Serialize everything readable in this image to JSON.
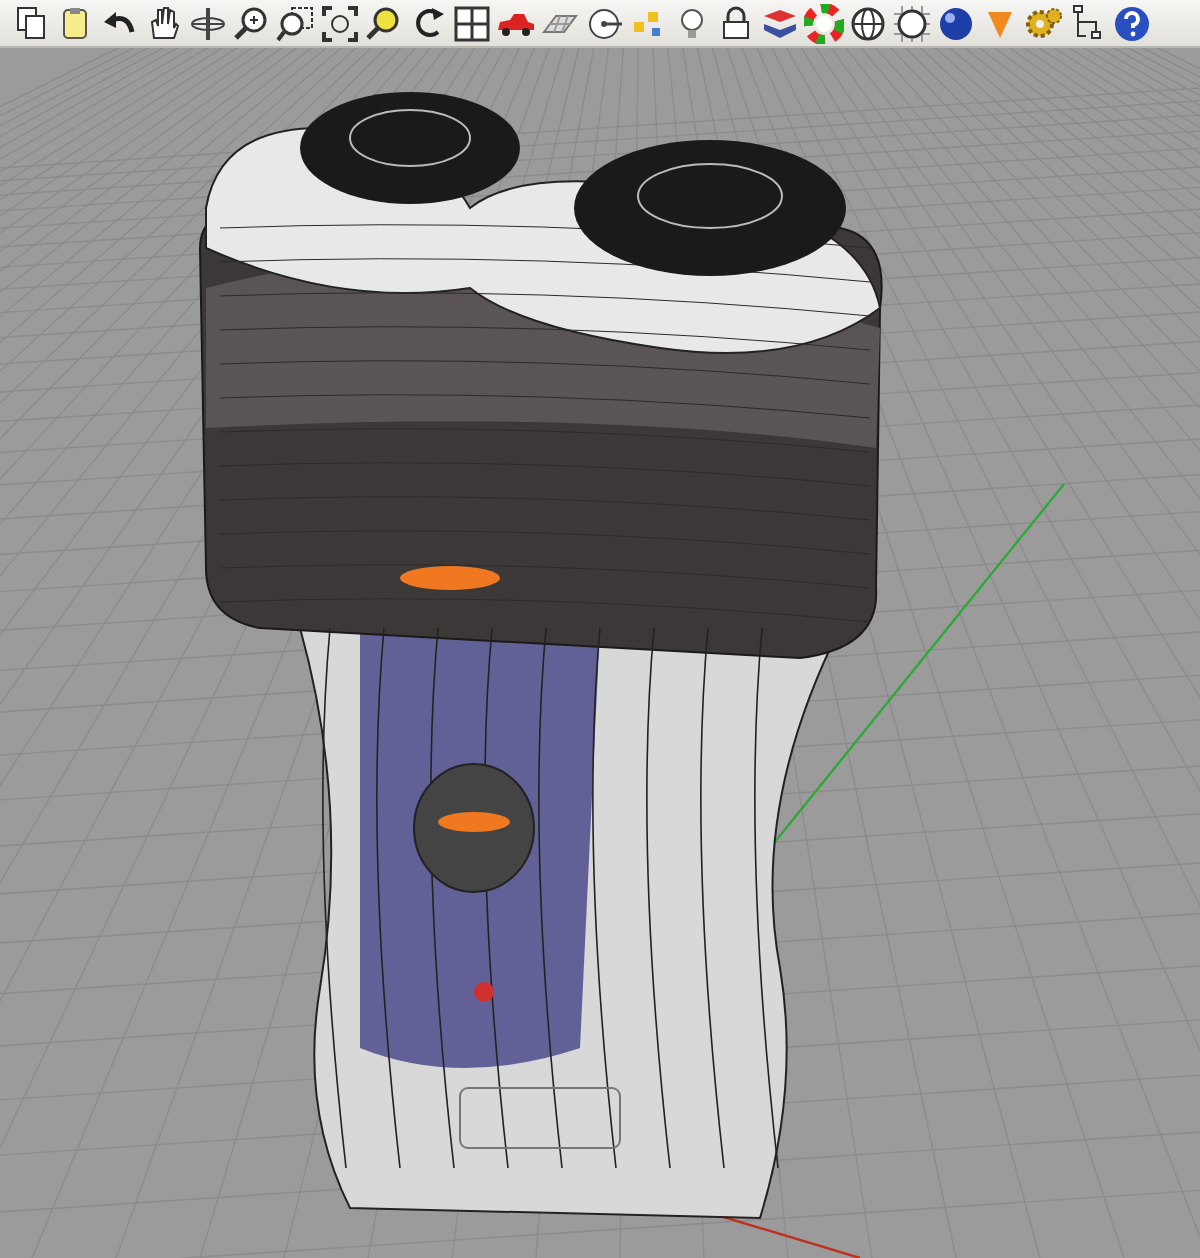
{
  "toolbar": {
    "buttons": [
      {
        "kind": "copy"
      },
      {
        "kind": "paste"
      },
      {
        "kind": "undo"
      },
      {
        "kind": "pan"
      },
      {
        "kind": "orbit"
      },
      {
        "kind": "zoom"
      },
      {
        "kind": "zoom-window"
      },
      {
        "kind": "zoom-extents"
      },
      {
        "kind": "zoom-selected"
      },
      {
        "kind": "undo-view"
      },
      {
        "kind": "four-viewports"
      },
      {
        "kind": "car"
      },
      {
        "kind": "grid-plane"
      },
      {
        "kind": "snap"
      },
      {
        "kind": "points"
      },
      {
        "kind": "bulb"
      },
      {
        "kind": "lock"
      },
      {
        "kind": "layers"
      },
      {
        "kind": "color-wheel"
      },
      {
        "kind": "wire-sphere"
      },
      {
        "kind": "grid-sphere"
      },
      {
        "kind": "shaded-sphere"
      },
      {
        "kind": "cone"
      },
      {
        "kind": "gears"
      },
      {
        "kind": "tree"
      },
      {
        "kind": "help"
      }
    ]
  },
  "viewport": {
    "axes": {
      "x": true,
      "y": true
    }
  }
}
